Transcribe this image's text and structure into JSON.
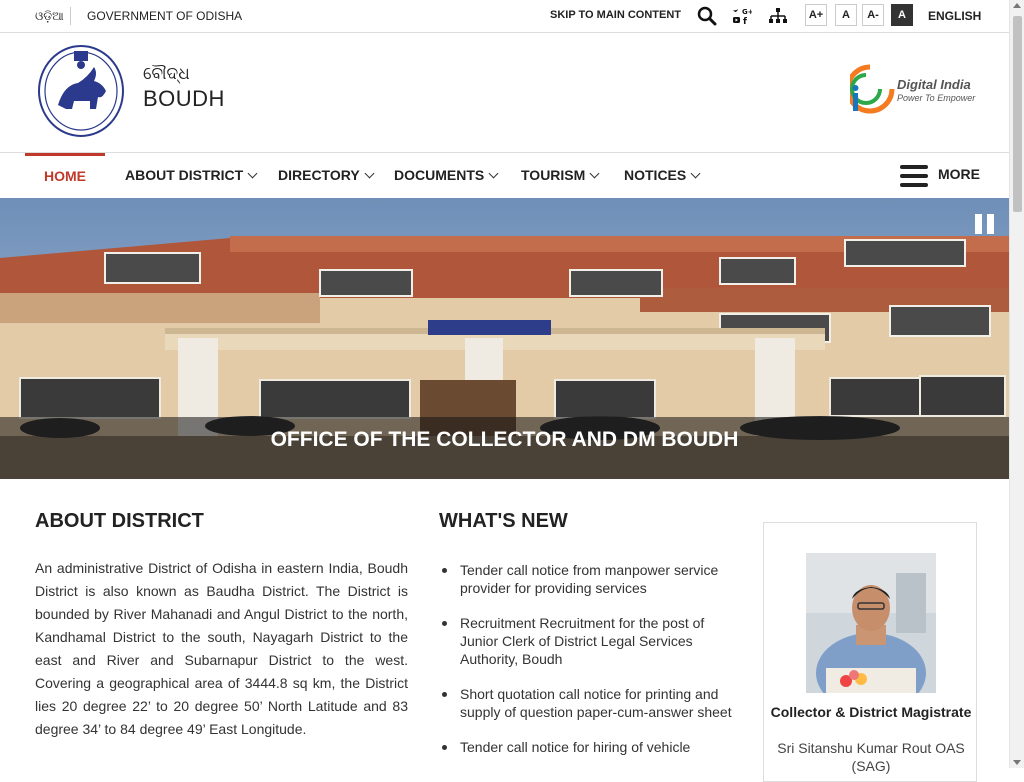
{
  "topbar": {
    "lang_odia": "ଓଡ଼ିଆ",
    "government": "GOVERNMENT OF ODISHA",
    "skip": "SKIP TO MAIN CONTENT",
    "font_increase": "A+",
    "font_normal": "A",
    "font_decrease": "A-",
    "contrast": "A",
    "language": "ENGLISH"
  },
  "header": {
    "name_odia": "ବୌଦ୍ଧ",
    "name": "BOUDH",
    "digital_india_title": "Digital India",
    "digital_india_tagline": "Power To Empower"
  },
  "nav": {
    "items": [
      {
        "label": "HOME"
      },
      {
        "label": "ABOUT DISTRICT"
      },
      {
        "label": "DIRECTORY"
      },
      {
        "label": "DOCUMENTS"
      },
      {
        "label": "TOURISM"
      },
      {
        "label": "NOTICES"
      }
    ],
    "more": "MORE"
  },
  "banner": {
    "caption": "OFFICE OF THE COLLECTOR AND DM BOUDH"
  },
  "about": {
    "title": "ABOUT DISTRICT",
    "text": "An administrative District of Odisha in eastern India, Boudh District is also known as Baudha District. The District is bounded by River Mahanadi and Angul District to the north, Kandhamal District to the south, Nayagarh District to the east and River and Subarnapur District to the west. Covering a geographical area of 3444.8 sq km, the District lies 20 degree 22’ to 20 degree 50’ North Latitude and 83 degree 34’ to 84 degree 49’ East Longitude."
  },
  "news": {
    "title": "WHAT'S NEW",
    "items": [
      "Tender call notice from manpower service provider for providing services",
      "Recruitment Recruitment for the post of Junior Clerk of District Legal Services Authority, Boudh",
      "Short quotation call notice for printing and supply of question paper-cum-answer sheet",
      "Tender call notice for hiring of vehicle"
    ]
  },
  "collector": {
    "role": "Collector & District Magistrate",
    "name": "Sri Sitanshu Kumar Rout OAS (SAG)"
  },
  "colors": {
    "accent": "#c0392b",
    "dark": "#222222"
  }
}
